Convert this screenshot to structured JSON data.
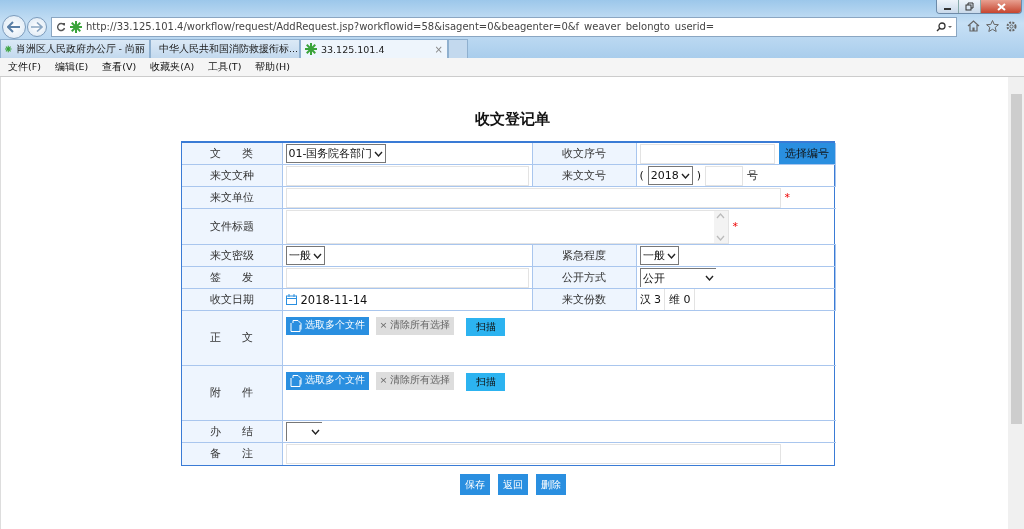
{
  "browser": {
    "url": "http://33.125.101.4/workflow/request/AddRequest.jsp?workflowid=58&isagent=0&beagenter=0&f_weaver_belongto_userid=",
    "tabs": [
      {
        "title": "肖洲区人民政府办公厅 - 尚丽",
        "selected": false
      },
      {
        "title": "中华人民共和国消防救援衔标...",
        "selected": false
      },
      {
        "title": "33.125.101.4",
        "selected": true,
        "close": "×"
      }
    ],
    "menu": [
      "文件(F)",
      "编辑(E)",
      "查看(V)",
      "收藏夹(A)",
      "工具(T)",
      "帮助(H)"
    ]
  },
  "form": {
    "title": "收文登记单",
    "rows": [
      {
        "kind": "pair",
        "cells": [
          {
            "label": "文 类",
            "control": {
              "kind": "select",
              "value": "01-国务院各部门"
            }
          },
          {
            "label": "收文序号",
            "control": {
              "kind": "input-button",
              "button": "选择编号"
            }
          }
        ]
      },
      {
        "kind": "pair",
        "cells": [
          {
            "label": "来文文种",
            "control": {
              "kind": "input"
            }
          },
          {
            "label": "来文文号",
            "control": {
              "kind": "doc-number",
              "open": "(",
              "year": "2018",
              "close": ")",
              "suffix": "号"
            }
          }
        ]
      },
      {
        "kind": "full",
        "label": "来文单位",
        "required_mark": "*",
        "control": {
          "kind": "input"
        }
      },
      {
        "kind": "full",
        "label": "文件标题",
        "required_mark": "*",
        "control": {
          "kind": "textarea"
        }
      },
      {
        "kind": "pair",
        "cells": [
          {
            "label": "来文密级",
            "control": {
              "kind": "select",
              "value": "一般"
            }
          },
          {
            "label": "紧急程度",
            "control": {
              "kind": "select",
              "value": "一般"
            }
          }
        ]
      },
      {
        "kind": "pair",
        "cells": [
          {
            "label": "签 发",
            "control": {
              "kind": "input"
            }
          },
          {
            "label": "公开方式",
            "control": {
              "kind": "select-wide",
              "value": "公开"
            }
          }
        ]
      },
      {
        "kind": "pair",
        "cells": [
          {
            "label": "收文日期",
            "control": {
              "kind": "date",
              "value": "2018-11-14"
            }
          },
          {
            "label": "来文份数",
            "control": {
              "kind": "copies",
              "items": [
                {
                  "label": "汉",
                  "value": "3"
                },
                {
                  "label": "维",
                  "value": "0"
                }
              ]
            }
          }
        ]
      },
      {
        "kind": "full",
        "label": "正 文",
        "control": {
          "kind": "files",
          "buttons": [
            {
              "label": "选取多个文件",
              "disabled": false
            },
            {
              "label": "× 清除所有选择",
              "disabled": true
            }
          ],
          "scan": "扫描"
        }
      },
      {
        "kind": "full",
        "label": "附 件",
        "control": {
          "kind": "files",
          "buttons": [
            {
              "label": "选取多个文件",
              "disabled": false
            },
            {
              "label": "× 清除所有选择",
              "disabled": true
            }
          ],
          "scan": "扫描"
        }
      },
      {
        "kind": "full",
        "label": "办 结",
        "control": {
          "kind": "select"
        }
      },
      {
        "kind": "full",
        "label": "备 注",
        "control": {
          "kind": "input"
        }
      }
    ],
    "actions": [
      "保存",
      "返回",
      "删除"
    ]
  }
}
